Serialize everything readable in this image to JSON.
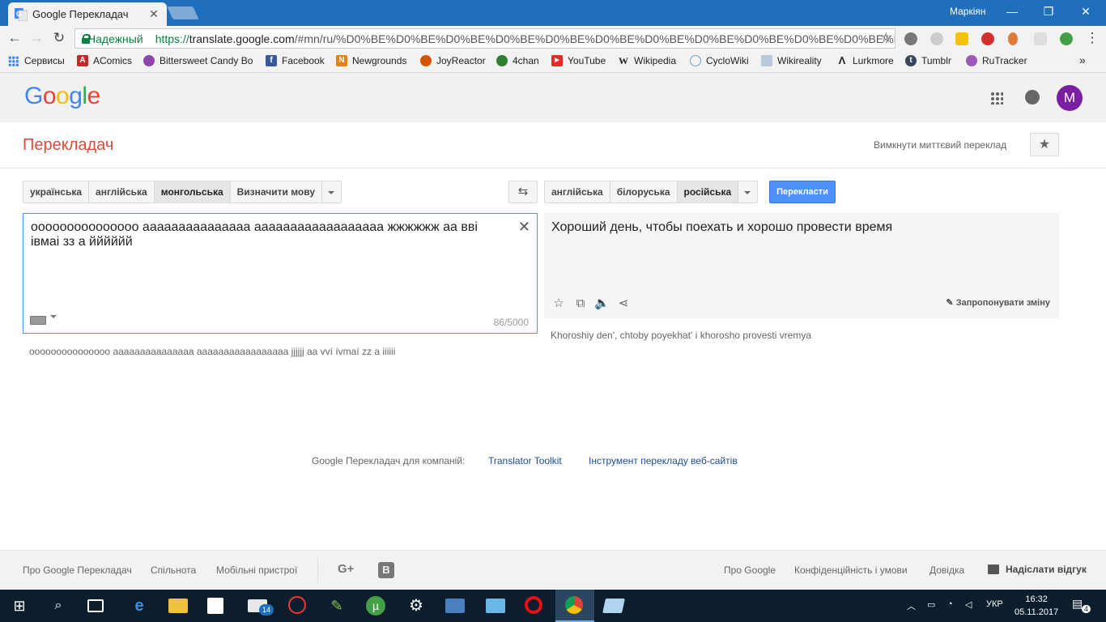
{
  "browser": {
    "tab_title": "Google Перекладач",
    "user_name": "Маркіян",
    "secure_label": "Надежный",
    "url_scheme": "https://",
    "url_host": "translate.google.com",
    "url_path": "/#mn/ru/%D0%BE%D0%BE%D0%BE%D0%BE%D0%BE%D0%BE%D0%BE%D0%BE%D0%BE%D0%BE%D0%BE%D0%BE%D0%BE%D0%BE%D0%BE%D0%BE%D0%BE%D0%BE%D0%BE%D0%BE%D0%BE%D0%BE%D0%BE%D0%BE%D0%BE%D0%BE%D0%BE%D0%BE%D0%BE%D0%BE%D0%BE%D0%BE%D0%BE%D0%BE%D0%BE..."
  },
  "bookmarks": [
    {
      "label": "Сервисы",
      "icon": "apps-grid-icon",
      "color": "#4285f4"
    },
    {
      "label": "AComics",
      "icon": "acomics-icon",
      "color": "#c62828"
    },
    {
      "label": "Bittersweet Candy Bo",
      "icon": "candy-icon",
      "color": "#8e44ad"
    },
    {
      "label": "Facebook",
      "icon": "facebook-icon",
      "color": "#3b5998"
    },
    {
      "label": "Newgrounds",
      "icon": "newgrounds-icon",
      "color": "#e6830c"
    },
    {
      "label": "JoyReactor",
      "icon": "joyreactor-icon",
      "color": "#d35400"
    },
    {
      "label": "4chan",
      "icon": "4chan-icon",
      "color": "#2e7d32"
    },
    {
      "label": "YouTube",
      "icon": "youtube-icon",
      "color": "#e52d27"
    },
    {
      "label": "Wikipedia",
      "icon": "wikipedia-icon",
      "color": "#222222"
    },
    {
      "label": "CycloWiki",
      "icon": "cyclowiki-icon",
      "color": "#7f9cc0"
    },
    {
      "label": "Wikireality",
      "icon": "wikireality-icon",
      "color": "#5c7fa8"
    },
    {
      "label": "Lurkmore",
      "icon": "lurkmore-icon",
      "color": "#333333"
    },
    {
      "label": "Tumblr",
      "icon": "tumblr-icon",
      "color": "#35465c"
    },
    {
      "label": "RuTracker",
      "icon": "rutracker-icon",
      "color": "#9b59b6"
    }
  ],
  "google": {
    "logo": "Google",
    "avatar_letter": "M",
    "avatar_color": "#7b1fa2"
  },
  "app": {
    "title": "Перекладач",
    "instant_off": "Вимкнути миттєвий переклад"
  },
  "source_langs": {
    "options": [
      "українська",
      "англійська",
      "монгольська",
      "Визначити мову"
    ],
    "selected": "монгольська"
  },
  "target_langs": {
    "options": [
      "англійська",
      "білоруська",
      "російська"
    ],
    "selected": "російська"
  },
  "translate_label": "Перекласти",
  "source": {
    "text": "ооооооооооооооо ааааааааааааааа аааааааааааааааааа жжжжжж аа вві івмаі зз а йййййй",
    "char_count": "86/5000",
    "transliteration": "ooooooooooooooo aaaaaaaaaaaaaaa aaaaaaaaaaaaaaaaa jjjjjj aa vví ívmaí zz a iiiiii"
  },
  "result": {
    "text": "Хороший день, чтобы поехать и хорошо провести время",
    "transliteration": "Khoroshiy den', chtoby poyekhat' i khorosho provesti vremya",
    "suggest_label": "Запропонувати зміну"
  },
  "business": {
    "label": "Google Перекладач для компаній:",
    "link1": "Translator Toolkit",
    "link2": "Інструмент перекладу веб-сайтів"
  },
  "footer": {
    "about_translate": "Про Google Перекладач",
    "community": "Спільнота",
    "mobile": "Мобільні пристрої",
    "about_google": "Про Google",
    "privacy": "Конфіденційність і умови",
    "help": "Довідка",
    "feedback": "Надіслати відгук"
  },
  "taskbar": {
    "mail_badge": "14",
    "lang": "УКР",
    "time": "16:32",
    "date": "05.11.2017",
    "notif_count": "4"
  }
}
